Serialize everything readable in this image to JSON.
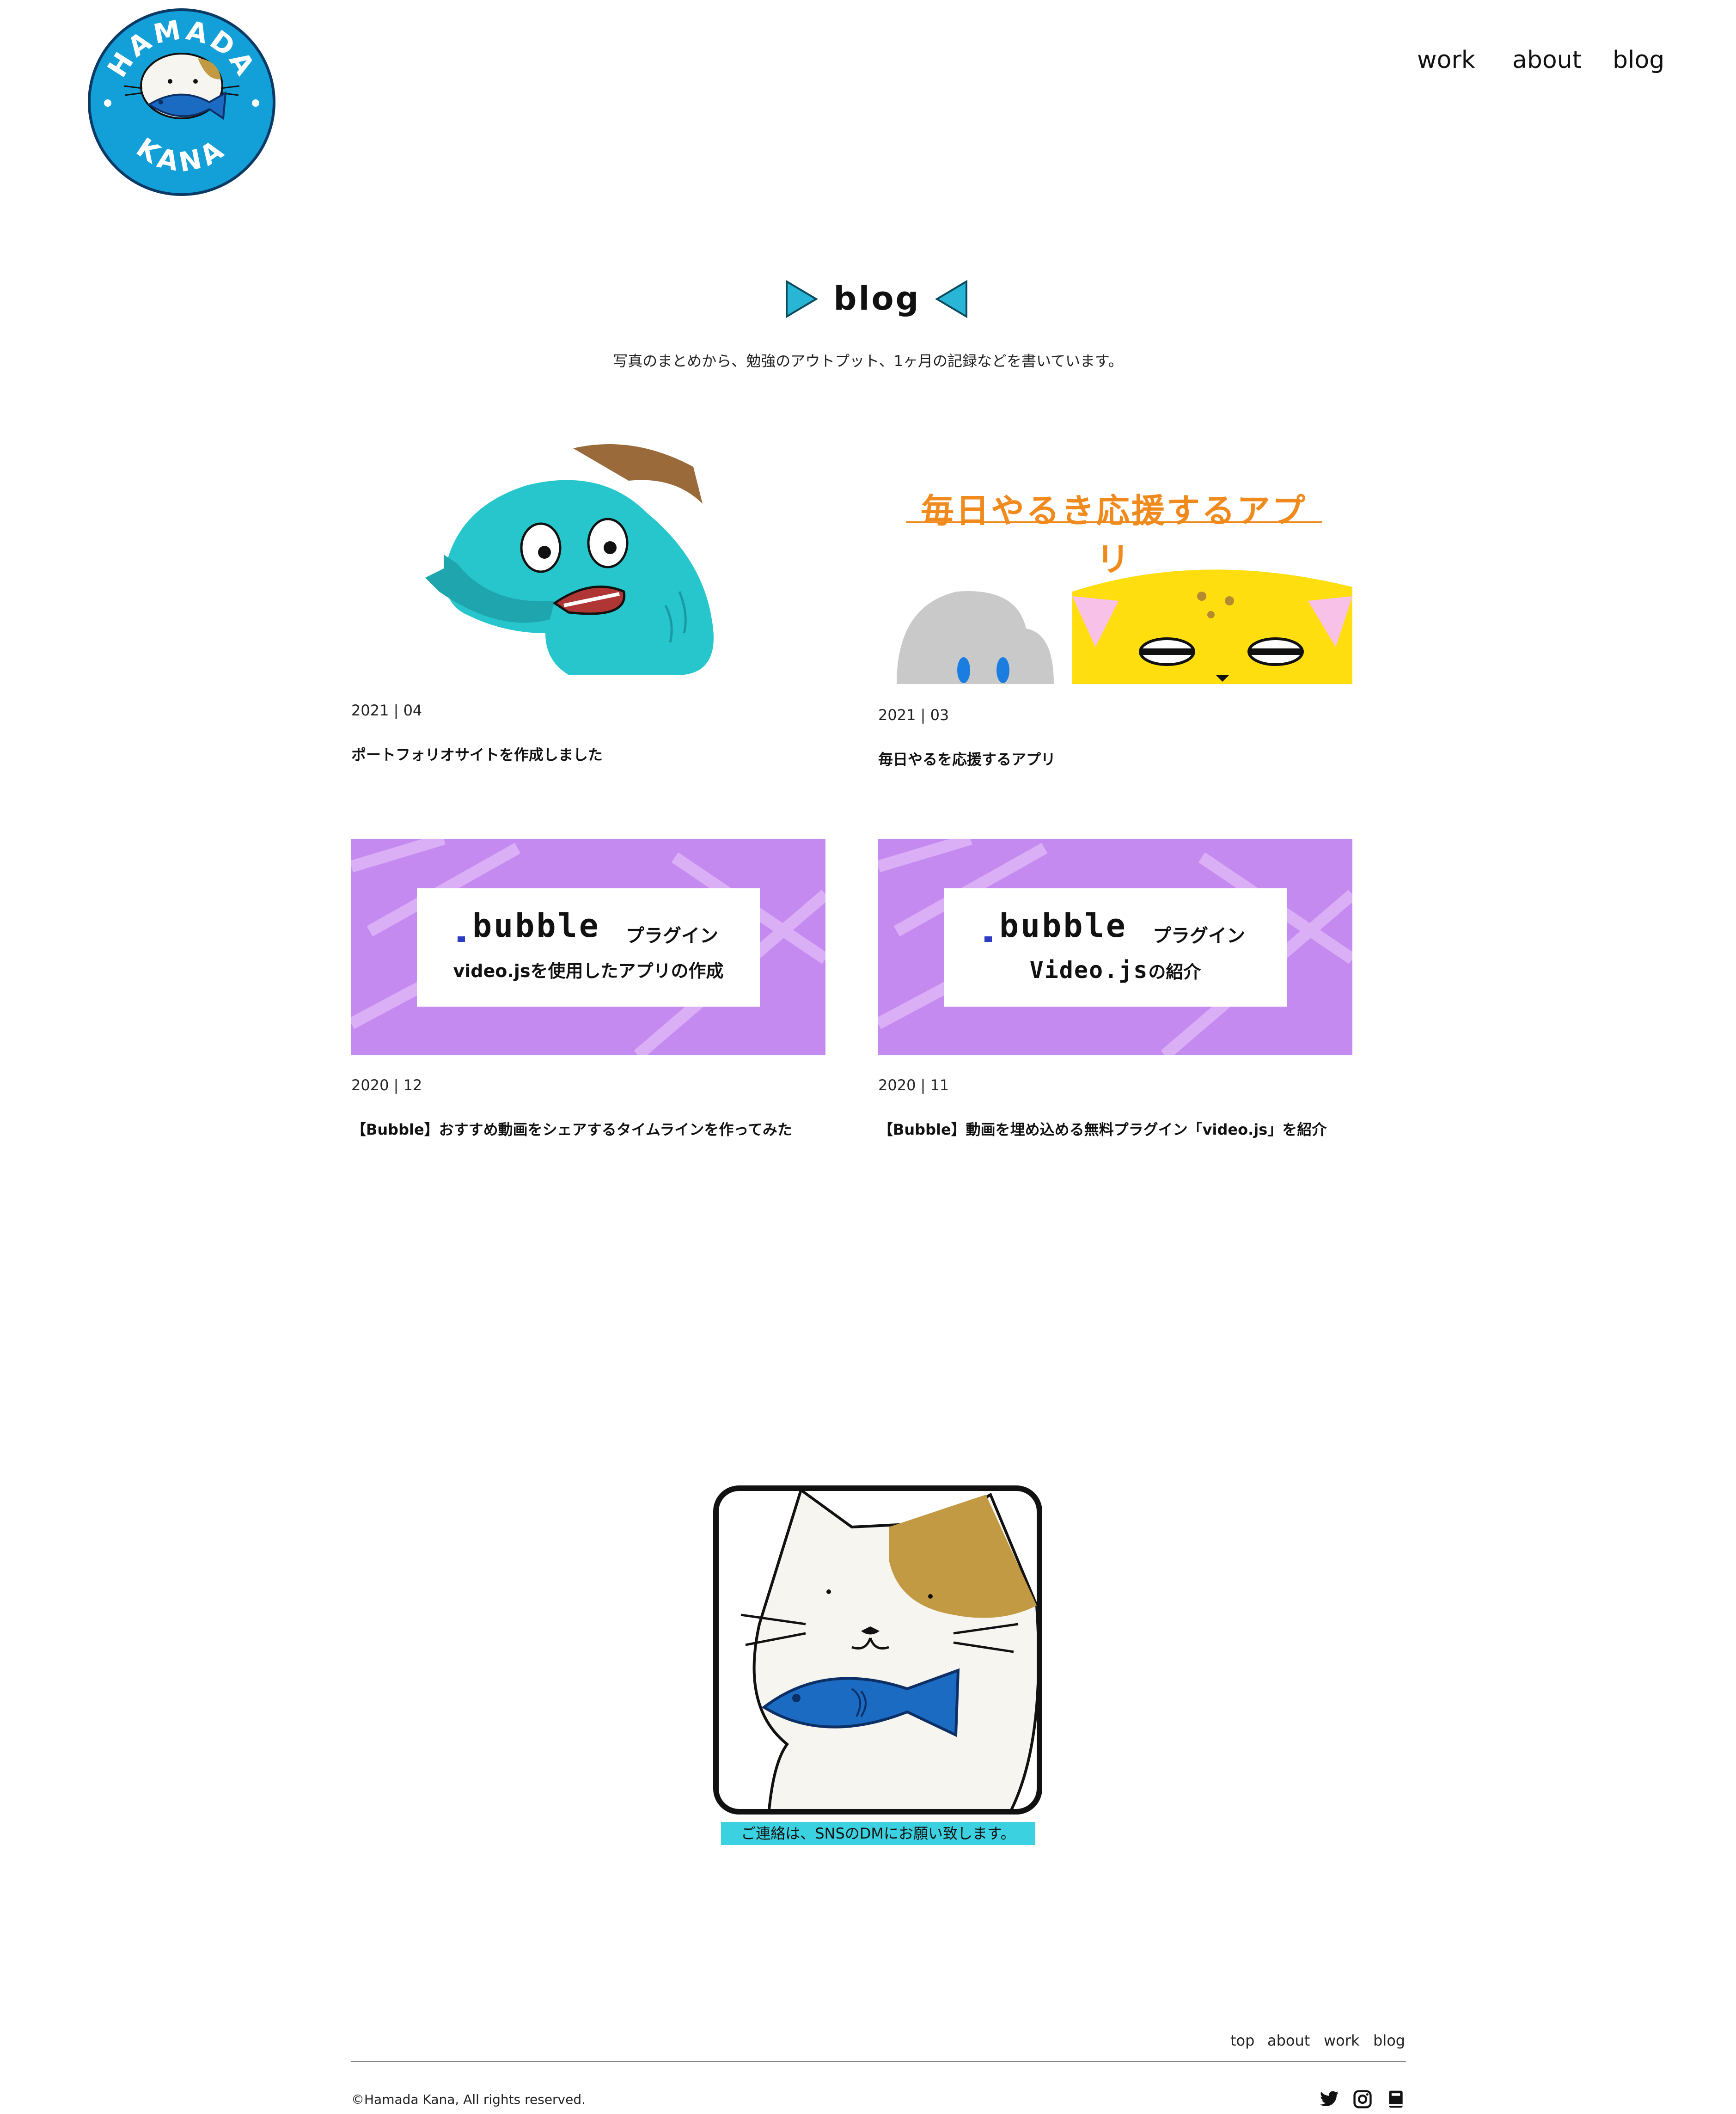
{
  "header": {
    "logo": {
      "text_top": "HAMADA",
      "text_bottom": "KANA",
      "color": "#139fd8"
    },
    "nav": [
      {
        "label": "work"
      },
      {
        "label": "about"
      },
      {
        "label": "blog"
      }
    ]
  },
  "section": {
    "title": "blog",
    "subtitle": "写真のまとめから、勉強のアウトプット、1ヶ月の記録などを書いています。",
    "accent_color": "#29b6d6"
  },
  "posts": [
    {
      "date": "2021 | 04",
      "title": "ポートフォリオサイトを作成しました",
      "thumb_icon": "teal-monster-illustration"
    },
    {
      "date": "2021 | 03",
      "title": "毎日やるを応援するアプリ",
      "thumb_icon": "app-banner-illustration",
      "thumb_heading": "毎日やるき応援するアプリ"
    },
    {
      "date": "2020 | 12",
      "title": "【Bubble】おすすめ動画をシェアするタイムラインを作ってみた",
      "thumb_icon": "bubble-banner",
      "thumb_brand": "bubble",
      "thumb_tag": "プラグイン",
      "thumb_sub": "video.jsを使用したアプリの作成"
    },
    {
      "date": "2020 | 11",
      "title": "【Bubble】動画を埋め込める無料プラグイン「video.js」を紹介",
      "thumb_icon": "bubble-banner",
      "thumb_brand": "bubble",
      "thumb_tag": "プラグイン",
      "thumb_sub_a": "Video.js",
      "thumb_sub_b": "の紹介"
    }
  ],
  "contact": {
    "image_icon": "calico-cat-with-fish-illustration",
    "message": "ご連絡は、SNSのDMにお願い致します。",
    "strip_color": "#3cd1e0"
  },
  "footer": {
    "links": [
      {
        "label": "top"
      },
      {
        "label": "about"
      },
      {
        "label": "work"
      },
      {
        "label": "blog"
      }
    ],
    "copyright": "©Hamada Kana, All rights reserved.",
    "sns": [
      "twitter-icon",
      "instagram-icon",
      "blog-book-icon"
    ]
  }
}
